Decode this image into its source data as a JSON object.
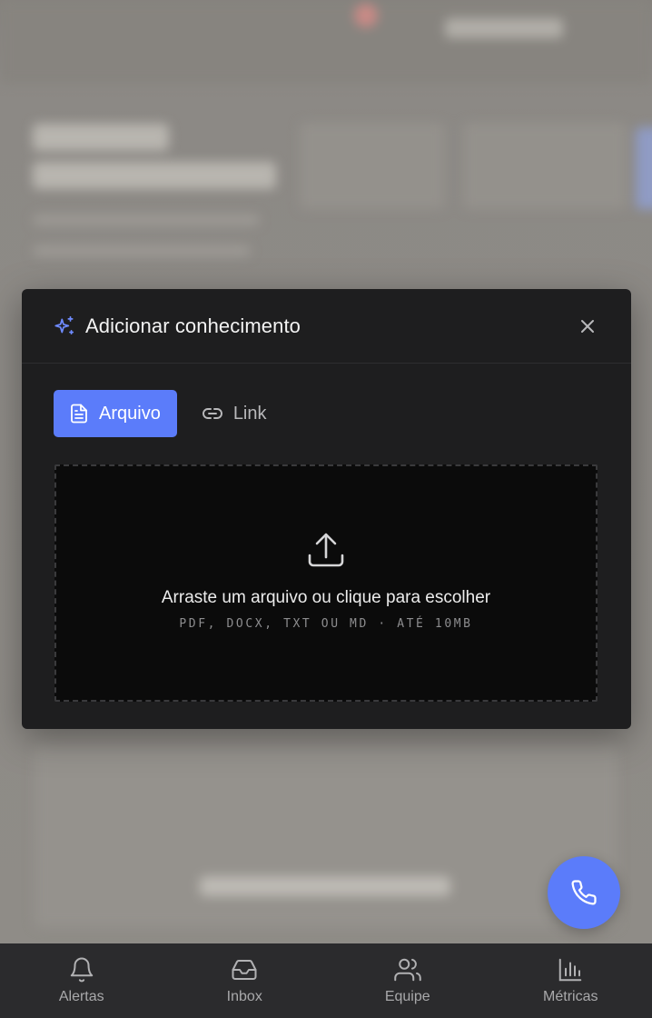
{
  "modal": {
    "title": "Adicionar conhecimento",
    "tabs": [
      {
        "label": "Arquivo",
        "icon": "file-text-icon",
        "active": true
      },
      {
        "label": "Link",
        "icon": "link-icon",
        "active": false
      }
    ],
    "dropzone": {
      "title": "Arraste um arquivo ou clique para escolher",
      "hint": "PDF, DOCX, TXT OU MD · ATÉ 10MB"
    }
  },
  "nav": {
    "items": [
      {
        "label": "Alertas",
        "icon": "bell-icon"
      },
      {
        "label": "Inbox",
        "icon": "inbox-icon"
      },
      {
        "label": "Equipe",
        "icon": "users-icon"
      },
      {
        "label": "Métricas",
        "icon": "bar-chart-icon"
      }
    ]
  },
  "colors": {
    "accent": "#5b7cfa",
    "modal_bg": "#1e1e1f",
    "dropzone_bg": "#0b0b0b",
    "nav_bg": "#2b2b2d"
  }
}
